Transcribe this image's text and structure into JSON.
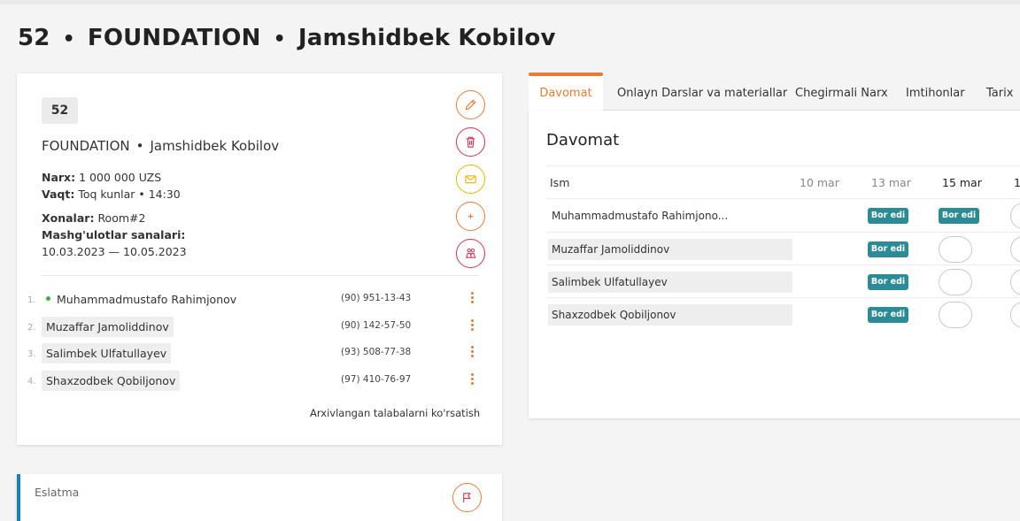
{
  "page_title": {
    "number": "52",
    "course": "FOUNDATION",
    "teacher": "Jamshidbek Kobilov",
    "separator": "•"
  },
  "group": {
    "badge": "52",
    "course": "FOUNDATION",
    "teacher": "Jamshidbek Kobilov",
    "price_label": "Narx:",
    "price_value": "1 000 000 UZS",
    "time_label": "Vaqt:",
    "time_value": "Toq kunlar  •  14:30",
    "rooms_label": "Xonalar:",
    "rooms_value": "Room#2",
    "dates_label": "Mashg'ulotlar sanalari:",
    "dates_value": "10.03.2023 — 10.05.2023",
    "actions": [
      {
        "name": "edit",
        "icon": "pencil-icon",
        "color": "#e97b32"
      },
      {
        "name": "delete",
        "icon": "trash-icon",
        "color": "#d9304f"
      },
      {
        "name": "message",
        "icon": "envelope-icon",
        "color": "#e8b800"
      },
      {
        "name": "add-student",
        "icon": "plus-icon",
        "color": "#e97b32"
      },
      {
        "name": "transfer",
        "icon": "people-icon",
        "color": "#d9304f"
      }
    ],
    "students": [
      {
        "num": "1.",
        "name": "Muhammadmustafo Rahimjonov",
        "phone": "(90) 951-13-43",
        "active": true
      },
      {
        "num": "2.",
        "name": "Muzaffar Jamoliddinov",
        "phone": "(90) 142-57-50",
        "active": false
      },
      {
        "num": "3.",
        "name": "Salimbek Ulfatullayev",
        "phone": "(93) 508-77-38",
        "active": false
      },
      {
        "num": "4.",
        "name": "Shaxzodbek Qobiljonov",
        "phone": "(97) 410-76-97",
        "active": false
      }
    ],
    "archive_link": "Arxivlangan talabalarni ko'rsatish"
  },
  "note": {
    "label": "Eslatma",
    "icon": "flag-icon"
  },
  "tabs": [
    "Davomat",
    "Onlayn Darslar va materiallar",
    "Chegirmali Narx",
    "Imtihonlar",
    "Tarix"
  ],
  "attendance": {
    "title": "Davomat",
    "columns": [
      "Ism",
      "10 mar",
      "13 mar",
      "15 mar",
      "1"
    ],
    "present_label": "Bor edi",
    "rows": [
      {
        "name": "Muhammadmustafo Rahimjono...",
        "marks": [
          "",
          "present",
          "present",
          "empty"
        ]
      },
      {
        "name": "Muzaffar Jamoliddinov",
        "marks": [
          "",
          "present",
          "empty",
          "empty"
        ]
      },
      {
        "name": "Salimbek Ulfatullayev",
        "marks": [
          "",
          "present",
          "empty",
          "empty"
        ]
      },
      {
        "name": "Shaxzodbek Qobiljonov",
        "marks": [
          "",
          "present",
          "empty",
          "empty"
        ]
      }
    ]
  },
  "colors": {
    "accent": "#e97b32",
    "present": "#2b8c97",
    "note_border": "#1a7fc1",
    "danger": "#d9304f",
    "warning": "#e8b800"
  }
}
